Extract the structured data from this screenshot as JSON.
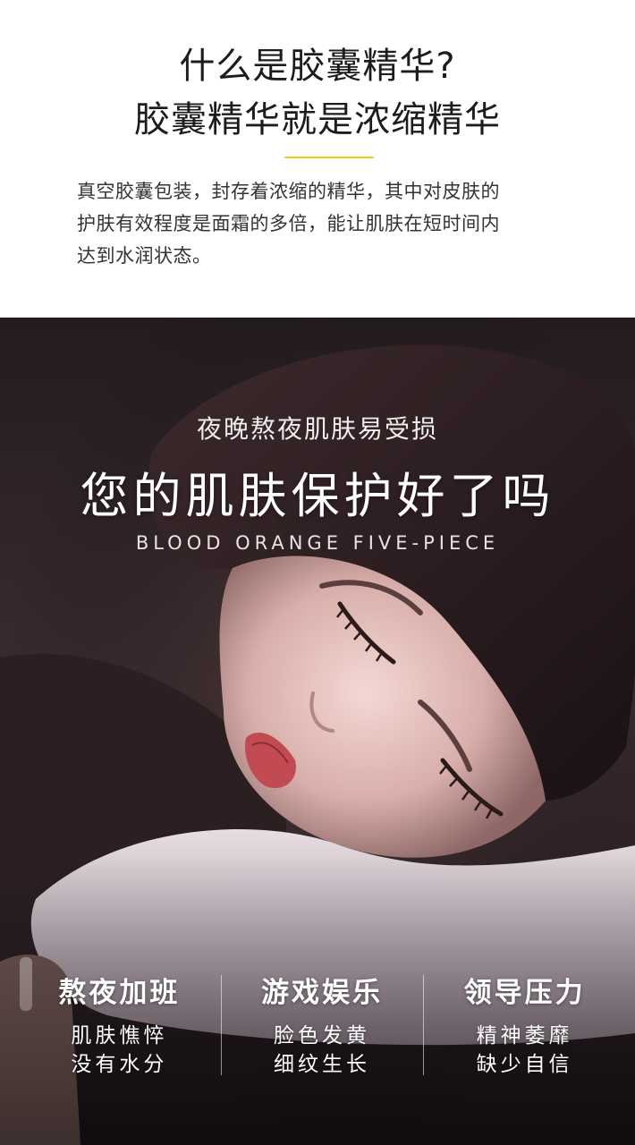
{
  "header": {
    "title_line1": "什么是胶囊精华?",
    "title_line2": "胶囊精华就是浓缩精华",
    "accent_color": "#f2c811"
  },
  "intro": {
    "lines": [
      "真空胶囊包装，封存着浓缩的精华，其中对皮肤的",
      "护肤有效程度是面霜的多倍，能让肌肤在短时间内",
      "达到水润状态。"
    ]
  },
  "hero": {
    "sub_heading": "夜晚熬夜肌肤易受损",
    "heading": "您的肌肤保护好了吗",
    "tagline": "BLOOD ORANGE FIVE-PIECE"
  },
  "features": [
    {
      "title": "熬夜加班",
      "line1": "肌肤憔悴",
      "line2": "没有水分"
    },
    {
      "title": "游戏娱乐",
      "line1": "脸色发黄",
      "line2": "细纹生长"
    },
    {
      "title": "领导压力",
      "line1": "精神萎靡",
      "line2": "缺少自信"
    }
  ]
}
